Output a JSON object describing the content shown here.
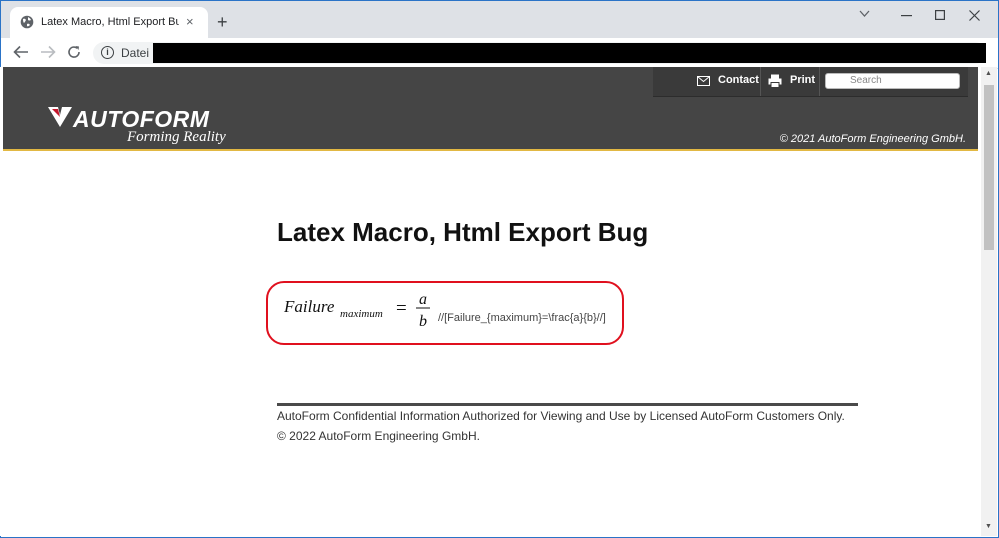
{
  "browser": {
    "tab_title": "Latex Macro, Html Export Bug - I",
    "tab_close": "×",
    "new_tab": "+",
    "omnibox_label": "Datei"
  },
  "site": {
    "nav_contact": "Contact",
    "nav_print": "Print",
    "search_placeholder": "Search",
    "logo_text": "AUTOFORM",
    "logo_tagline": "Forming Reality",
    "header_copyright": "© 2021 AutoForm Engineering GmbH."
  },
  "content": {
    "title": "Latex Macro, Html Export Bug",
    "formula": {
      "lhs": "Failure",
      "subscript": "maximum",
      "equals": "=",
      "numerator": "a",
      "denominator": "b"
    },
    "latex_source": "//[Failure_{maximum}=\\frac{a}{b}//]"
  },
  "footer": {
    "confidential": "AutoForm Confidential Information Authorized for Viewing and Use by Licensed AutoForm Customers Only.",
    "copyright": "© 2022 AutoForm Engineering GmbH."
  },
  "colors": {
    "header_bg": "#454545",
    "header_accent": "#e2b843",
    "highlight_border": "#e0101e",
    "logo_red": "#c4172c"
  }
}
